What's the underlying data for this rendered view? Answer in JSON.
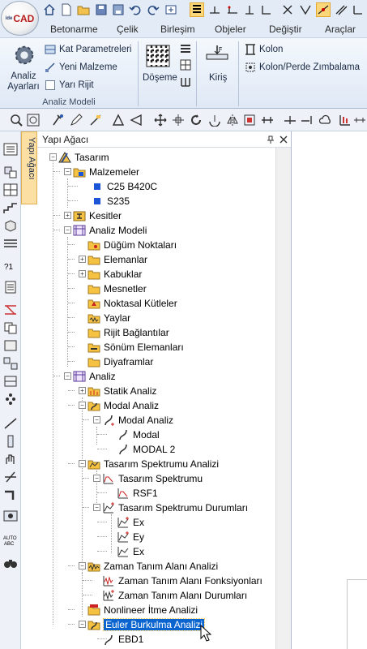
{
  "app": {
    "logo_text": "CAD",
    "logo_prefix": "ide"
  },
  "ribbon": {
    "tabs": [
      "Betonarme",
      "Çelik",
      "Birleşim",
      "Objeler",
      "Değiştir",
      "Araçlar"
    ],
    "analysis_settings": "Analiz\nAyarları",
    "analysis_settings_l1": "Analiz",
    "analysis_settings_l2": "Ayarları",
    "floor_params": "Kat Parametreleri",
    "new_material": "Yeni Malzeme",
    "semi_rigid": "Yarı Rijit",
    "group_label": "Analiz Modeli",
    "slab": "Döşeme",
    "beam": "Kiriş",
    "column": "Kolon",
    "column_wall_punch": "Kolon/Perde Zımbalama"
  },
  "panel": {
    "title": "Yapı Ağacı",
    "side_tab": "Yapı Ağacı"
  },
  "tree": {
    "root": "Tasarım",
    "materials": "Malzemeler",
    "mat1": "C25 B420C",
    "mat2": "S235",
    "sections": "Kesitler",
    "analysis_model": "Analiz Modeli",
    "nodes": "Düğüm Noktaları",
    "elements": "Elemanlar",
    "shells": "Kabuklar",
    "supports": "Mesnetler",
    "point_masses": "Noktasal Kütleler",
    "springs": "Yaylar",
    "rigid_links": "Rijit Bağlantılar",
    "dampers": "Sönüm Elemanları",
    "diaphragms": "Diyaframlar",
    "analysis": "Analiz",
    "static": "Statik Analiz",
    "modal": "Modal Analiz",
    "modal_sub": "Modal Analiz",
    "modal1": "Modal",
    "modal2": "MODAL 2",
    "rsa": "Tasarım Spektrumu Analizi",
    "spectrum": "Tasarım Spektrumu",
    "rsf1": "RSF1",
    "spectrum_cases": "Tasarım Spektrumu Durumları",
    "ex": "Ex",
    "ey": "Ey",
    "ex2": "Ex",
    "time_history": "Zaman Tanım Alanı Analizi",
    "th_functions": "Zaman Tanım Alanı Fonksiyonları",
    "th_cases": "Zaman Tanım Alanı Durumları",
    "pushover": "Nonlineer İtme Analizi",
    "buckling": "Euler Burkulma Analizi",
    "ebd1": "EBD1"
  },
  "colors": {
    "selection": "#0a64d0",
    "folder": "#f5c242",
    "accent": "#fbd77a"
  }
}
